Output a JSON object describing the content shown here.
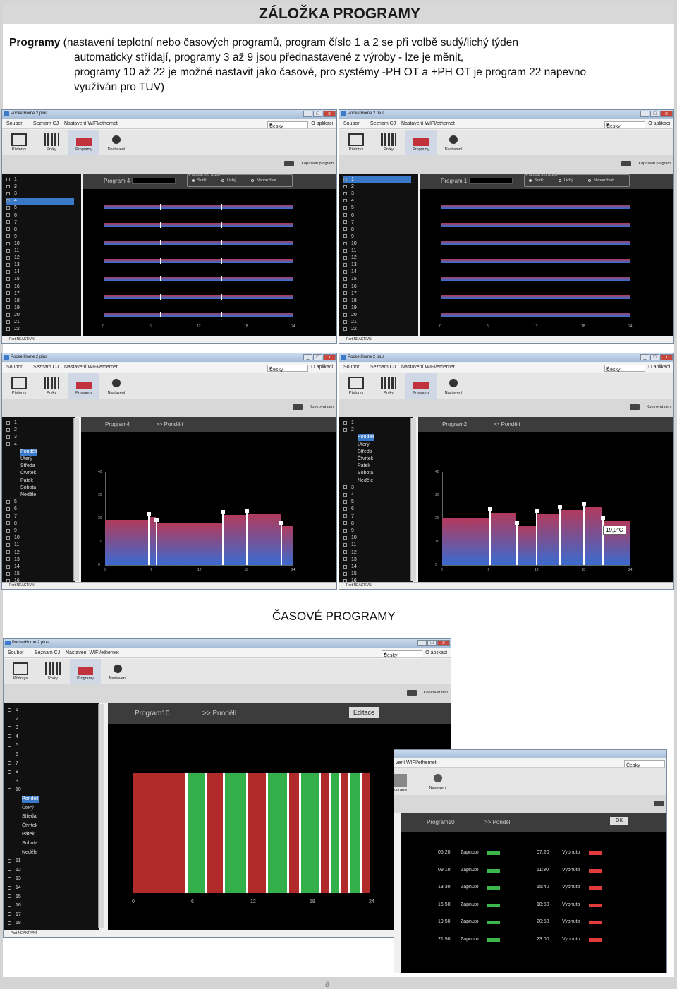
{
  "header": {
    "title": "ZÁLOŽKA PROGRAMY"
  },
  "description": {
    "bold": "Programy",
    "line1": " (nastavení teplotní nebo časových programů, program číslo 1 a 2 se při volbě sudý/lichý týden",
    "line2": "automaticky střídají, programy 3 až 9 jsou přednastavené z výroby - lze je měnit,",
    "line3": "programy 10 až 22 je možné nastavit jako časové, pro systémy -PH OT a +PH OT je program 22 napevno",
    "line4": "využíván pro TUV)"
  },
  "app": {
    "title": "PocketHome 2 plus",
    "menu": [
      "Soubor",
      "Seznam CJ",
      "Nastavení WIFI/ethernet",
      "O aplikaci"
    ],
    "language": "Česky",
    "toolbar": [
      "Půdorys",
      "Prvky",
      "Programy",
      "Nastavení"
    ],
    "copy_program": "Kopírovat program",
    "copy_day": "Kopírovat den",
    "status": "Port NEAKTIVNÍ"
  },
  "program_numbers": [
    "1",
    "2",
    "3",
    "4",
    "5",
    "6",
    "7",
    "8",
    "9",
    "10",
    "11",
    "12",
    "13",
    "14",
    "15",
    "16",
    "17",
    "18",
    "19",
    "20",
    "21",
    "22"
  ],
  "days": [
    "Pondělí",
    "Úterý",
    "Středa",
    "Čtvrtek",
    "Pátek",
    "Sobota",
    "Neděle"
  ],
  "week_validity": {
    "label": "Platnost pro týden",
    "options": [
      "Sudý",
      "Lichý",
      "Nepoužívat"
    ]
  },
  "win1": {
    "program": "Program 4",
    "selected": "4"
  },
  "win2": {
    "program": "Program 1",
    "selected": "1"
  },
  "win3": {
    "program": "Program4",
    "day": ">> Pondělí"
  },
  "win4": {
    "program": "Program2",
    "day": ">> Pondělí",
    "tooltip": "19,0°C"
  },
  "x_ticks": [
    "0",
    "6",
    "12",
    "18",
    "24"
  ],
  "y_ticks": [
    "40",
    "30",
    "20",
    "10",
    "0"
  ],
  "time_section": {
    "title": "ČASOVÉ PROGRAMY"
  },
  "win5": {
    "program": "Program10",
    "day": ">> Pondělí",
    "edit": "Editace",
    "menu_partial": "vení WIFI/ethernet",
    "toolbar_partial": "ogramy"
  },
  "win6": {
    "program": "Program10",
    "day": ">> Pondělí",
    "ok": "OK",
    "rows": [
      {
        "on": "05:20",
        "on_label": "Zapnuto",
        "off": "07:20",
        "off_label": "Vypnuto"
      },
      {
        "on": "09:10",
        "on_label": "Zapnuto",
        "off": "11:30",
        "off_label": "Vypnuto"
      },
      {
        "on": "13:30",
        "on_label": "Zapnuto",
        "off": "15:40",
        "off_label": "Vypnuto"
      },
      {
        "on": "16:50",
        "on_label": "Zapnuto",
        "off": "18:50",
        "off_label": "Vypnuto"
      },
      {
        "on": "19:50",
        "on_label": "Zapnuto",
        "off": "20:50",
        "off_label": "Vypnuto"
      },
      {
        "on": "21:50",
        "on_label": "Zapnuto",
        "off": "23:00",
        "off_label": "Vypnuto"
      }
    ]
  },
  "page_number": "8"
}
